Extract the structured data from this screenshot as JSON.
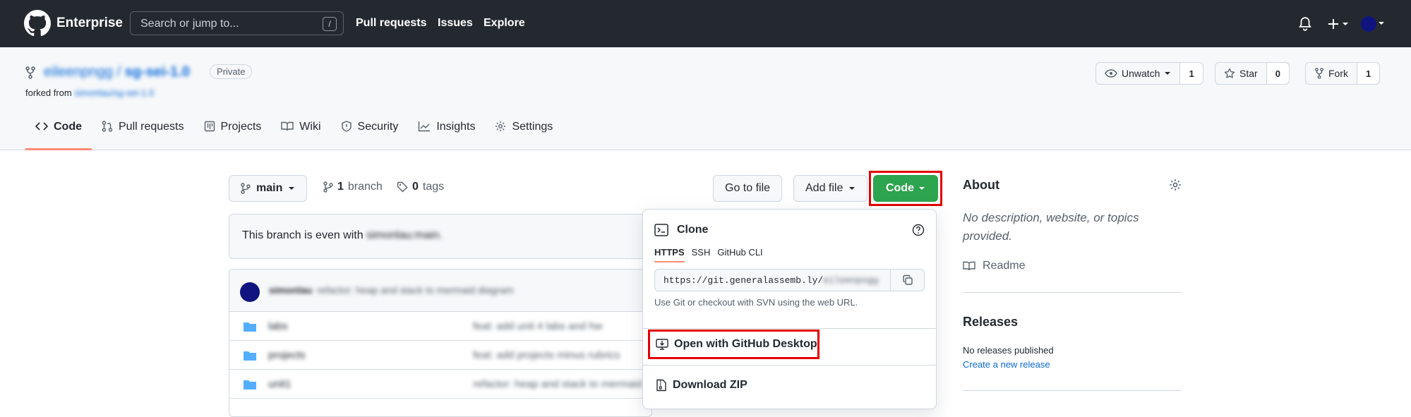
{
  "header": {
    "brand": "Enterprise",
    "search_placeholder": "Search or jump to...",
    "search_shortcut": "/",
    "nav": [
      "Pull requests",
      "Issues",
      "Explore"
    ]
  },
  "repo": {
    "owner": "eileenpngg",
    "separator": "/",
    "name": "sg-sei-1.0",
    "visibility": "Private",
    "forked_from_label": "forked from",
    "forked_from": "simonlau/sg-sei-1.0",
    "watch": {
      "label": "Unwatch",
      "count": "1"
    },
    "star": {
      "label": "Star",
      "count": "0"
    },
    "fork": {
      "label": "Fork",
      "count": "1"
    },
    "tabs": [
      "Code",
      "Pull requests",
      "Projects",
      "Wiki",
      "Security",
      "Insights",
      "Settings"
    ]
  },
  "toolbar": {
    "branch": "main",
    "branch_count": "1",
    "branch_label": "branch",
    "tag_count": "0",
    "tag_label": "tags",
    "go_to_file": "Go to file",
    "add_file": "Add file",
    "code": "Code"
  },
  "flash": {
    "text": "This branch is even with ",
    "ref": "simonlau:main."
  },
  "commit": {
    "author": "simonlau",
    "message": "refactor: heap and stack to mermaid diagram"
  },
  "files": [
    {
      "name": "labs",
      "message": "feat: add unit 4 labs and hw"
    },
    {
      "name": "projects",
      "message": "feat: add projects minus rubrics"
    },
    {
      "name": "unit1",
      "message": "refactor: heap and stack to mermaid"
    }
  ],
  "clone": {
    "title": "Clone",
    "tabs": [
      "HTTPS",
      "SSH",
      "GitHub CLI"
    ],
    "url": "https://git.generalassemb.ly/",
    "url_blurred": "eileenpngg",
    "hint": "Use Git or checkout with SVN using the web URL.",
    "desktop": "Open with GitHub Desktop",
    "zip": "Download ZIP"
  },
  "sidebar": {
    "about_title": "About",
    "about_text": "No description, website, or topics provided.",
    "readme": "Readme",
    "releases_title": "Releases",
    "no_releases": "No releases published",
    "create_release": "Create a new release"
  },
  "colors": {
    "header_bg": "#24292f",
    "code_button": "#2da44e",
    "highlight": "#e30000",
    "tab_underline": "#fd8c73",
    "link": "#0969da"
  }
}
